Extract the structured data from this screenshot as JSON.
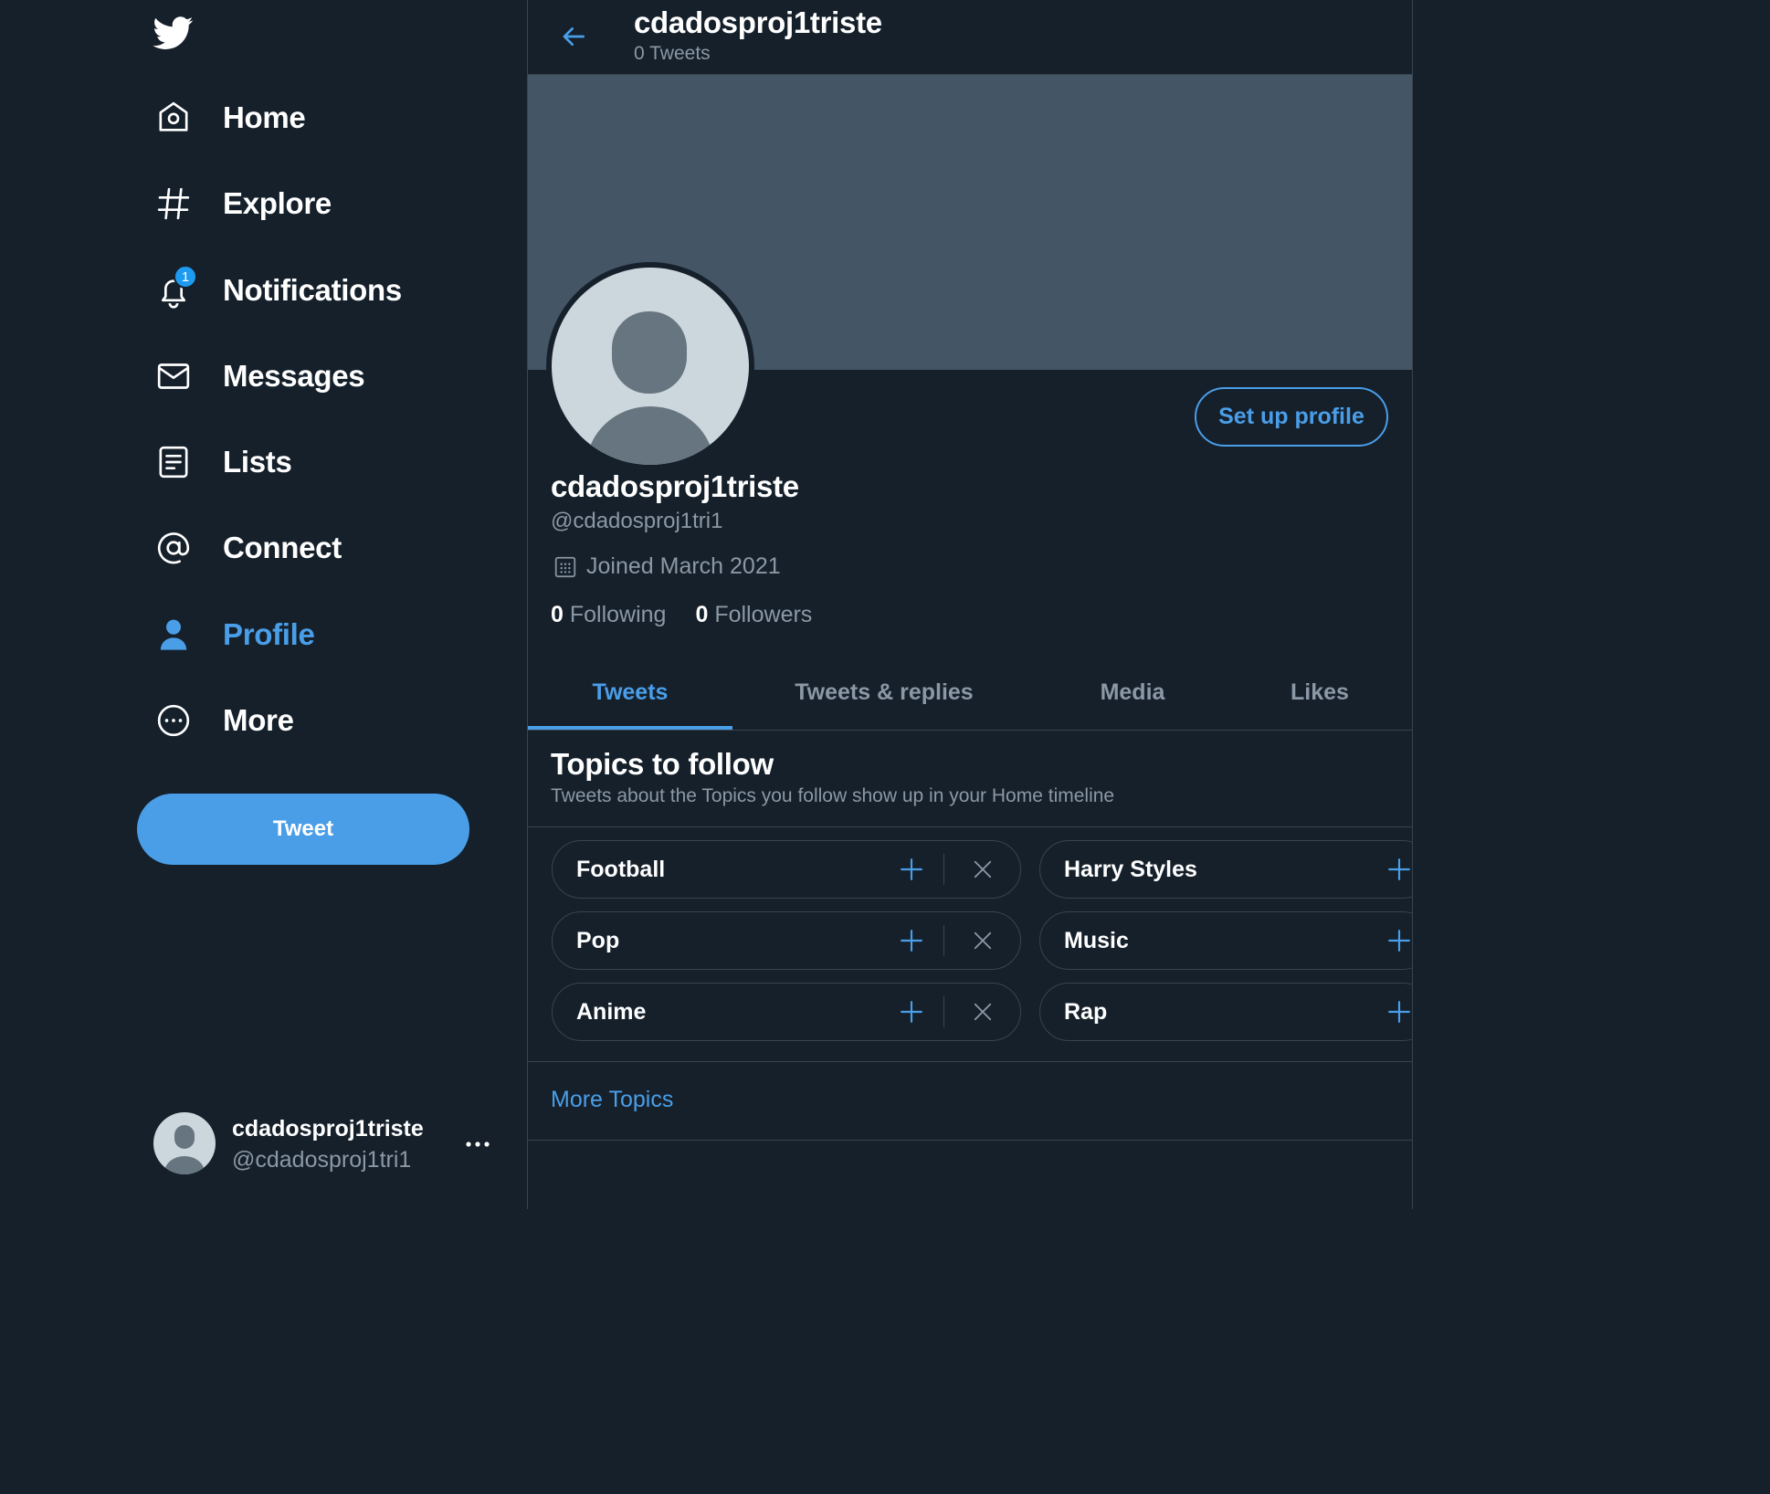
{
  "colors": {
    "background": "#15202b",
    "accent": "#4a9ee8",
    "banner": "#445566",
    "muted_text": "#8b98a5",
    "border": "#38444d"
  },
  "sidebar": {
    "logo_icon": "twitter-bird-icon",
    "items": [
      {
        "label": "Home",
        "icon": "home-icon"
      },
      {
        "label": "Explore",
        "icon": "hashtag-icon"
      },
      {
        "label": "Notifications",
        "icon": "bell-icon",
        "badge": "1"
      },
      {
        "label": "Messages",
        "icon": "envelope-icon"
      },
      {
        "label": "Lists",
        "icon": "list-icon"
      },
      {
        "label": "Connect",
        "icon": "at-sign-icon"
      },
      {
        "label": "Profile",
        "icon": "person-icon",
        "active": true
      },
      {
        "label": "More",
        "icon": "more-circle-icon"
      }
    ],
    "tweet_button": "Tweet",
    "account": {
      "name": "cdadosproj1triste",
      "handle": "@cdadosproj1tri1"
    }
  },
  "header": {
    "title": "cdadosproj1triste",
    "subtitle": "0 Tweets"
  },
  "profile": {
    "setup_button": "Set up profile",
    "name": "cdadosproj1triste",
    "handle": "@cdadosproj1tri1",
    "joined": "Joined March 2021",
    "following_count": "0",
    "following_label": "Following",
    "followers_count": "0",
    "followers_label": "Followers"
  },
  "tabs": [
    {
      "label": "Tweets",
      "active": true
    },
    {
      "label": "Tweets & replies"
    },
    {
      "label": "Media"
    },
    {
      "label": "Likes"
    }
  ],
  "topics": {
    "title": "Topics to follow",
    "subtitle": "Tweets about the Topics you follow show up in your Home timeline",
    "left": [
      "Football",
      "Pop",
      "Anime"
    ],
    "right": [
      "Harry Styles",
      "Music",
      "Rap"
    ],
    "more_label": "More Topics"
  }
}
